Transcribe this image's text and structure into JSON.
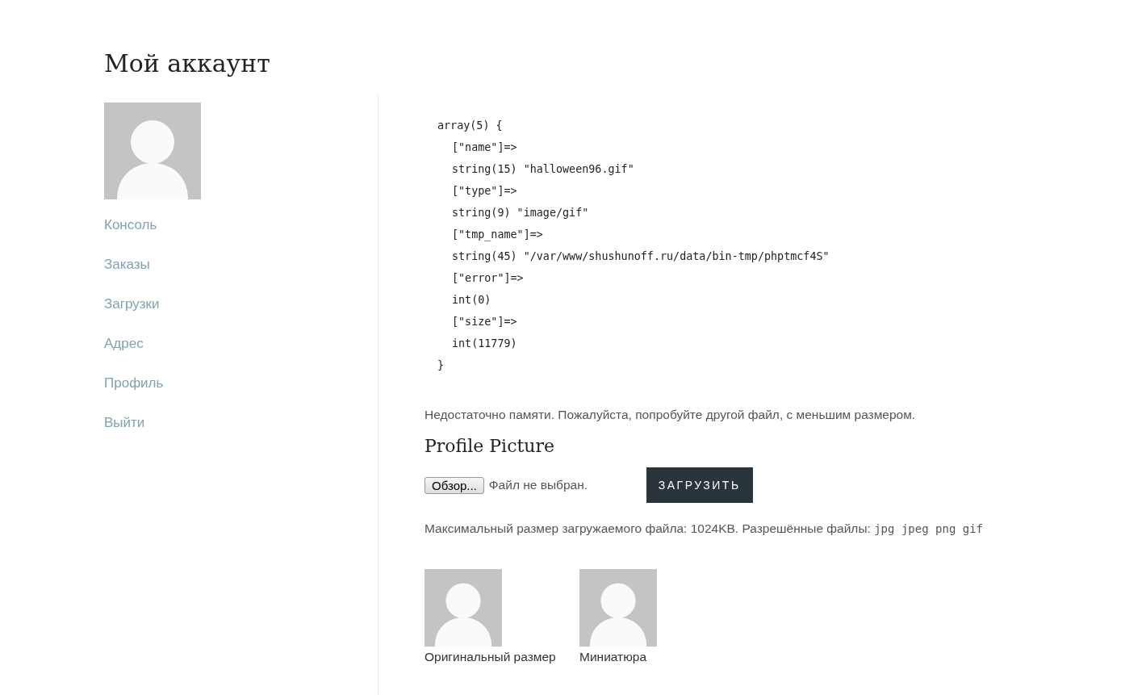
{
  "page_title": "Мой аккаунт",
  "sidebar": {
    "items": [
      {
        "label": "Консоль"
      },
      {
        "label": "Заказы"
      },
      {
        "label": "Загрузки"
      },
      {
        "label": "Адрес"
      },
      {
        "label": "Профиль"
      },
      {
        "label": "Выйти"
      }
    ]
  },
  "debug_dump": {
    "open": "array(5) {",
    "lines": [
      "[\"name\"]=>",
      "string(15) \"halloween96.gif\"",
      "[\"type\"]=>",
      "string(9) \"image/gif\"",
      "[\"tmp_name\"]=>",
      "string(45) \"/var/www/shushunoff.ru/data/bin-tmp/phptmcf4S\"",
      "[\"error\"]=>",
      "int(0)",
      "[\"size\"]=>",
      "int(11779)"
    ],
    "close": "}"
  },
  "error_message": "Недостаточно памяти. Пожалуйста, попробуйте другой файл, с меньшим размером.",
  "section_title": "Profile Picture",
  "file_input": {
    "button": "Обзор...",
    "status": "Файл не выбран."
  },
  "upload_button": "ЗАГРУЗИТЬ",
  "limits": {
    "text": "Максимальный размер загружаемого файла: 1024KB. Разрешённые файлы:",
    "types": "jpg jpeg png gif"
  },
  "previews": [
    {
      "caption": "Оригинальный размер"
    },
    {
      "caption": "Миниатюра"
    }
  ]
}
